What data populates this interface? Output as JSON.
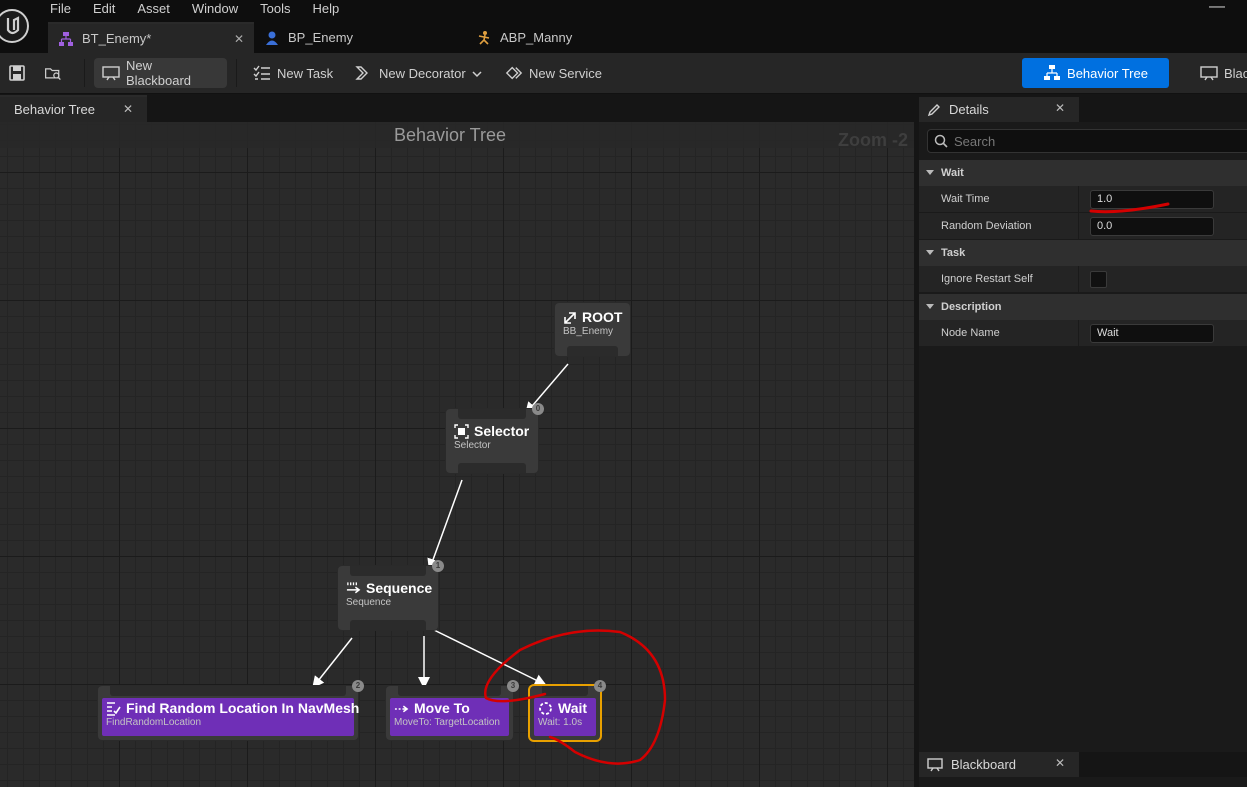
{
  "menu": [
    "File",
    "Edit",
    "Asset",
    "Window",
    "Tools",
    "Help"
  ],
  "window_controls": {
    "minimize": "—"
  },
  "doc_tabs": [
    {
      "label": "BT_Enemy*",
      "close": "✕"
    },
    {
      "label": "BP_Enemy"
    },
    {
      "label": "ABP_Manny"
    }
  ],
  "toolbar": {
    "new_blackboard": "New Blackboard",
    "new_task": "New Task",
    "new_decorator": "New Decorator",
    "new_service": "New Service",
    "behavior_tree": "Behavior Tree",
    "blackboard_cut": "Blac"
  },
  "graph": {
    "tab_label": "Behavior Tree",
    "tab_close": "✕",
    "title": "Behavior Tree",
    "zoom": "Zoom -2",
    "nodes": {
      "root": {
        "title": "ROOT",
        "sub": "BB_Enemy"
      },
      "selector": {
        "title": "Selector",
        "sub": "Selector",
        "order": "0"
      },
      "sequence": {
        "title": "Sequence",
        "sub": "Sequence",
        "order": "1"
      },
      "find": {
        "title": "Find Random Location In NavMesh",
        "sub": "FindRandomLocation",
        "order": "2"
      },
      "moveto": {
        "title": "Move To",
        "sub": "MoveTo: TargetLocation",
        "order": "3"
      },
      "wait": {
        "title": "Wait",
        "sub": "Wait: 1.0s",
        "order": "4"
      }
    }
  },
  "details": {
    "tab_label": "Details",
    "tab_close": "✕",
    "search_placeholder": "Search",
    "categories": {
      "wait": "Wait",
      "task": "Task",
      "description": "Description"
    },
    "props": {
      "wait_time_label": "Wait Time",
      "wait_time_value": "1.0",
      "random_deviation_label": "Random Deviation",
      "random_deviation_value": "0.0",
      "ignore_restart_label": "Ignore Restart Self",
      "node_name_label": "Node Name",
      "node_name_value": "Wait"
    }
  },
  "blackboard_panel": {
    "tab_label": "Blackboard",
    "tab_close": "✕"
  },
  "colors": {
    "accent": "#0070e0",
    "task": "#6f2fb7",
    "selection": "#e8a000",
    "annotation": "#d40000"
  }
}
